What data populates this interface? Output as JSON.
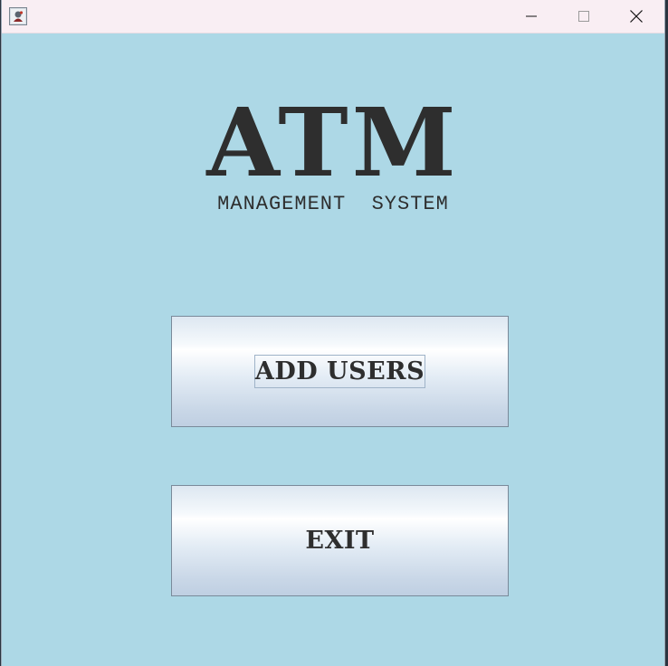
{
  "window": {
    "icon": "java-app-icon",
    "controls": {
      "minimize_icon": "minimize-icon",
      "maximize_icon": "maximize-icon",
      "close_icon": "close-icon"
    }
  },
  "logo": {
    "main": "ATM",
    "subtitle": "MANAGEMENT  SYSTEM"
  },
  "buttons": {
    "add_users": "ADD USERS",
    "exit": "EXIT"
  },
  "colors": {
    "background": "#add8e6",
    "titlebar": "#f9eef3",
    "text": "#2e2e2e"
  }
}
